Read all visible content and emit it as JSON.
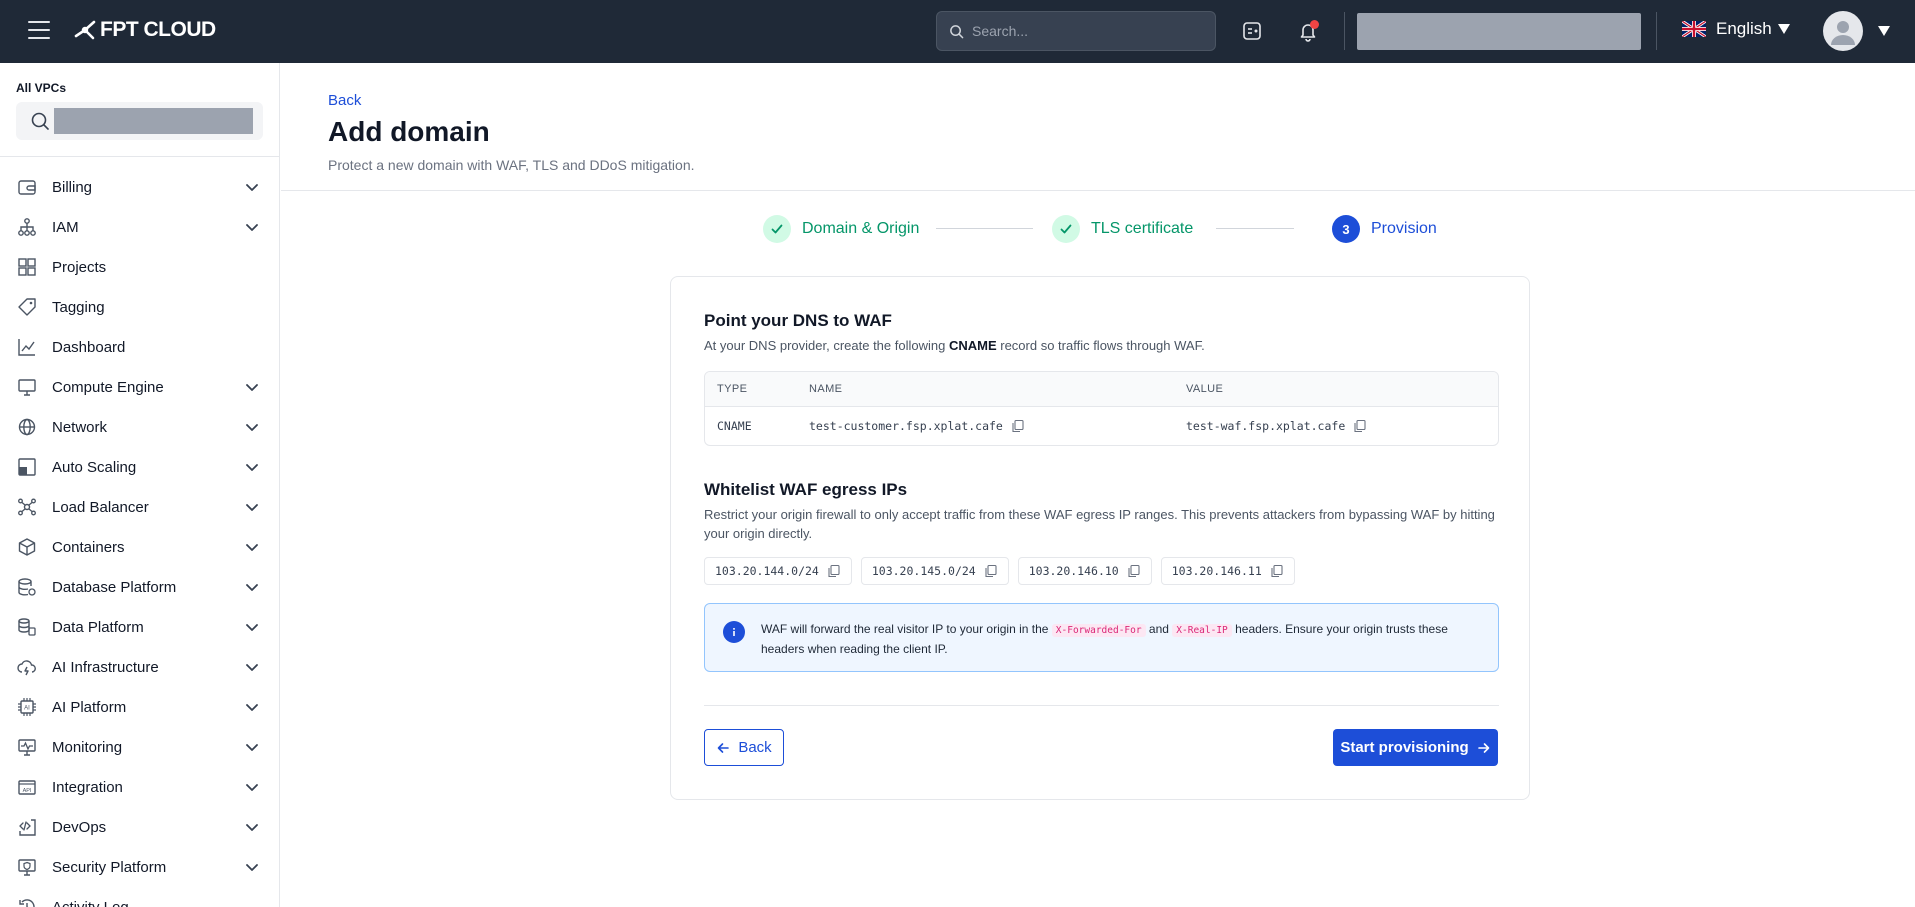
{
  "header": {
    "logo_text": "FPT CLOUD",
    "search_placeholder": "Search...",
    "language": "English"
  },
  "sidebar": {
    "vpc_label": "All VPCs",
    "items": [
      {
        "label": "Billing",
        "icon": "wallet-icon",
        "expandable": true
      },
      {
        "label": "IAM",
        "icon": "hierarchy-icon",
        "expandable": true
      },
      {
        "label": "Projects",
        "icon": "grid-icon",
        "expandable": false
      },
      {
        "label": "Tagging",
        "icon": "tag-icon",
        "expandable": false
      },
      {
        "label": "Dashboard",
        "icon": "chart-icon",
        "expandable": false
      },
      {
        "label": "Compute Engine",
        "icon": "monitor-icon",
        "expandable": true
      },
      {
        "label": "Network",
        "icon": "globe-icon",
        "expandable": true
      },
      {
        "label": "Auto Scaling",
        "icon": "scaling-icon",
        "expandable": true
      },
      {
        "label": "Load Balancer",
        "icon": "nodes-icon",
        "expandable": true
      },
      {
        "label": "Containers",
        "icon": "cube-icon",
        "expandable": true
      },
      {
        "label": "Database Platform",
        "icon": "database-icon",
        "expandable": true
      },
      {
        "label": "Data Platform",
        "icon": "data-stack-icon",
        "expandable": true
      },
      {
        "label": "AI Infrastructure",
        "icon": "cloud-bolt-icon",
        "expandable": true
      },
      {
        "label": "AI Platform",
        "icon": "ai-chip-icon",
        "expandable": true
      },
      {
        "label": "Monitoring",
        "icon": "pulse-monitor-icon",
        "expandable": true
      },
      {
        "label": "Integration",
        "icon": "api-icon",
        "expandable": true
      },
      {
        "label": "DevOps",
        "icon": "code-window-icon",
        "expandable": true
      },
      {
        "label": "Security Platform",
        "icon": "shield-icon",
        "expandable": true
      },
      {
        "label": "Activity Log",
        "icon": "history-icon",
        "expandable": false
      }
    ]
  },
  "page": {
    "back_link": "Back",
    "title": "Add domain",
    "subtitle": "Protect a new domain with WAF, TLS and DDoS mitigation."
  },
  "stepper": {
    "steps": [
      {
        "label": "Domain & Origin",
        "state": "done",
        "number": "1"
      },
      {
        "label": "TLS certificate",
        "state": "done",
        "number": "2"
      },
      {
        "label": "Provision",
        "state": "active",
        "number": "3"
      }
    ]
  },
  "dns": {
    "title": "Point your DNS to WAF",
    "desc_before": "At your DNS provider, create the following ",
    "desc_bold": "CNAME",
    "desc_after": " record so traffic flows through WAF.",
    "headers": [
      "TYPE",
      "NAME",
      "VALUE"
    ],
    "row": {
      "type": "CNAME",
      "name": "test-customer.fsp.xplat.cafe",
      "value": "test-waf.fsp.xplat.cafe"
    }
  },
  "whitelist": {
    "title": "Whitelist WAF egress IPs",
    "desc": "Restrict your origin firewall to only accept traffic from these WAF egress IP ranges. This prevents attackers from bypassing WAF by hitting your origin directly.",
    "ips": [
      "103.20.144.0/24",
      "103.20.145.0/24",
      "103.20.146.10",
      "103.20.146.11"
    ]
  },
  "info": {
    "text_1": "WAF will forward the real visitor IP to your origin in the ",
    "code_1": "X-Forwarded-For",
    "text_2": " and ",
    "code_2": "X-Real-IP",
    "text_3": " headers. Ensure your origin trusts these headers when reading the client IP."
  },
  "actions": {
    "back": "Back",
    "primary": "Start provisioning"
  },
  "colors": {
    "header_bg": "#1f2937",
    "accent": "#1d4ed8",
    "success": "#059669",
    "notification": "#ef4444"
  }
}
